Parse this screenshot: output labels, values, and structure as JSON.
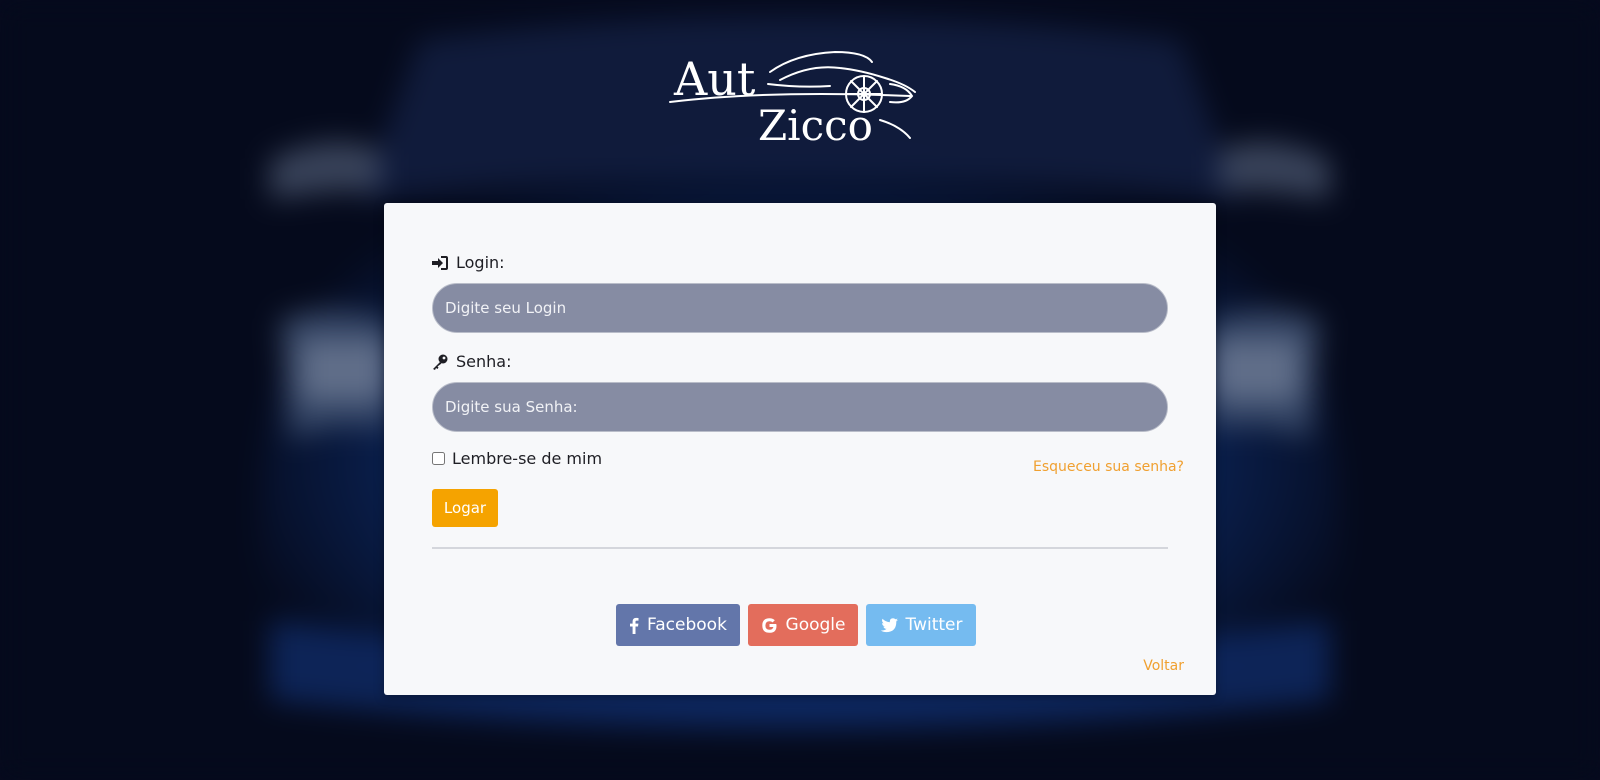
{
  "brand": {
    "logo_word_1": "Aut",
    "logo_word_2": "Zicco"
  },
  "form": {
    "login_label": "Login:",
    "login_placeholder": "Digite seu Login",
    "password_label": "Senha:",
    "password_placeholder": "Digite sua Senha:",
    "remember_label": "Lembre-se de mim",
    "forgot_link": "Esqueceu sua senha?",
    "submit_label": "Logar"
  },
  "social": {
    "facebook_label": "Facebook",
    "google_label": "Google",
    "twitter_label": "Twitter"
  },
  "back_link": "Voltar",
  "colors": {
    "accent": "#f5a300",
    "link": "#f0a030",
    "input_bg": "#868ca3",
    "facebook": "#6376aa",
    "google": "#e36d5c",
    "twitter": "#75bbf0"
  },
  "icons": {
    "login": "sign-in-icon",
    "password": "key-icon",
    "facebook": "facebook-icon",
    "google": "google-icon",
    "twitter": "twitter-icon"
  }
}
